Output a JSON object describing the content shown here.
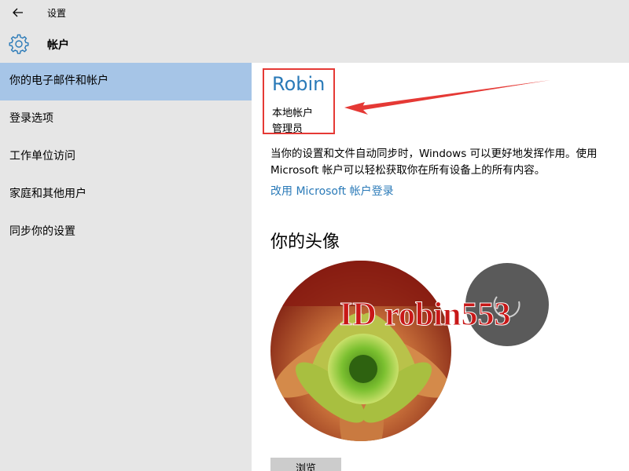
{
  "titlebar": {
    "back_icon": "back-arrow-icon",
    "title": "设置"
  },
  "header": {
    "icon": "gear-icon",
    "title": "帐户"
  },
  "sidebar": {
    "items": [
      {
        "label": "你的电子邮件和帐户",
        "selected": true
      },
      {
        "label": "登录选项",
        "selected": false
      },
      {
        "label": "工作单位访问",
        "selected": false
      },
      {
        "label": "家庭和其他用户",
        "selected": false
      },
      {
        "label": "同步你的设置",
        "selected": false
      }
    ]
  },
  "account": {
    "name": "Robin",
    "type": "本地帐户",
    "role": "管理员"
  },
  "description": "当你的设置和文件自动同步时，Windows 可以更好地发挥作用。使用 Microsoft 帐户可以轻松获取你在所有设备上的所有内容。",
  "ms_link": "改用 Microsoft 帐户登录",
  "avatar": {
    "heading": "你的头像",
    "watermark": "ID robin553"
  },
  "browse_button": "浏览",
  "colors": {
    "accent": "#2a7ab8",
    "selected_bg": "#a6c5e7",
    "sidebar_bg": "#e6e6e6",
    "highlight_red": "#e53935"
  }
}
